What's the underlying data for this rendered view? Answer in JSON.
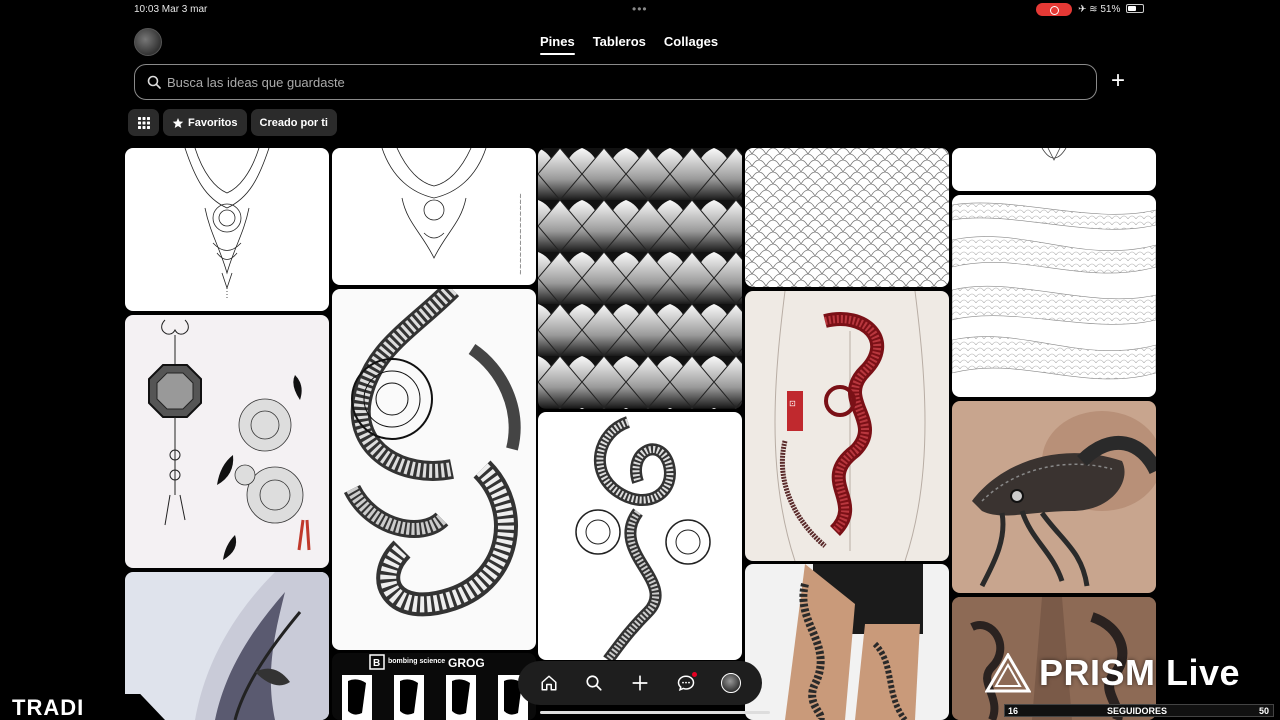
{
  "status_bar": {
    "time_date": "10:03  Mar 3 mar",
    "battery": "51%"
  },
  "header": {
    "tabs": [
      {
        "label": "Pines",
        "active": true
      },
      {
        "label": "Tableros",
        "active": false
      },
      {
        "label": "Collages",
        "active": false
      }
    ]
  },
  "search": {
    "placeholder": "Busca las ideas que guardaste",
    "icon": "search-icon"
  },
  "filters": {
    "grid_icon": "grid-icon",
    "favorites_label": "Favoritos",
    "created_label": "Creado por ti"
  },
  "pins": [
    {
      "desc": "mandala-ornament-sketch"
    },
    {
      "desc": "ornament-sketch"
    },
    {
      "desc": "dragon-scales-pattern"
    },
    {
      "desc": "fish-scale-grid"
    },
    {
      "desc": "ornament-tip"
    },
    {
      "desc": "scale-waves-pattern"
    },
    {
      "desc": "lantern-and-peony-drawing"
    },
    {
      "desc": "dragon-coil-drawing"
    },
    {
      "desc": "snake-coil-drawing"
    },
    {
      "desc": "red-snake-back-design"
    },
    {
      "desc": "cobra-shoulder-tattoo"
    },
    {
      "desc": "arm-sleeve-photo"
    },
    {
      "desc": "lettering-flash"
    },
    {
      "desc": "leg-tattoo-photo"
    },
    {
      "desc": "forearm-tattoo-photo"
    }
  ],
  "lettering_brands": {
    "left": "bombing science",
    "right": "GROG"
  },
  "bottom_nav": [
    "home-icon",
    "search-icon",
    "plus-icon",
    "messages-icon",
    "profile-avatar"
  ],
  "overlay": {
    "tradi": "TRADI",
    "prism_text": "PRISM Live",
    "followers_start": "16",
    "followers_label": "SEGUIDORES",
    "followers_goal": "50"
  }
}
